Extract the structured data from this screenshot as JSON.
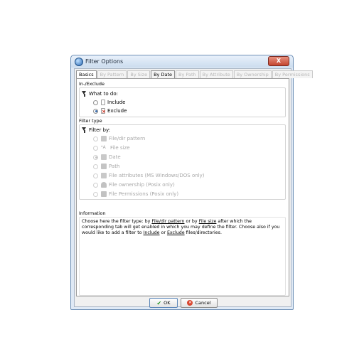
{
  "window": {
    "title": "Filter Options",
    "close_label": "X"
  },
  "tabs": [
    {
      "label": "Basics"
    },
    {
      "label": "By Pattern"
    },
    {
      "label": "By Size"
    },
    {
      "label": "By Date"
    },
    {
      "label": "By Path"
    },
    {
      "label": "By Attribute"
    },
    {
      "label": "By Ownership"
    },
    {
      "label": "By Permissions"
    }
  ],
  "include_exclude": {
    "title": "In-/Exclude",
    "what_to_do": "What to do:",
    "options": [
      {
        "label": "Include",
        "selected": false
      },
      {
        "label": "Exclude",
        "selected": true
      }
    ]
  },
  "filter_type": {
    "title": "Filter type",
    "filter_by": "Filter by:",
    "options": [
      {
        "label": "File/dir pattern",
        "selected": false
      },
      {
        "label": "File size",
        "selected": false
      },
      {
        "label": "Date",
        "selected": true
      },
      {
        "label": "Path",
        "selected": false
      },
      {
        "label": "File attributes (MS Windows/DOS only)",
        "selected": false
      },
      {
        "label": "File ownership (Posix only)",
        "selected": false
      },
      {
        "label": "File Permissions (Posix only)",
        "selected": false
      }
    ]
  },
  "information": {
    "title": "Information",
    "t1": "Choose here the filter type: by ",
    "link1": "File/dir pattern",
    "t2": " or by ",
    "link2": "File size",
    "t3": " after which the corresponding tab will get enabled in which you may define the filter. Choose also if you would like to add a filter to ",
    "link3": "Include",
    "t4": " or ",
    "link4": "Exclude",
    "t5": " files/directories."
  },
  "buttons": {
    "ok": "OK",
    "cancel": "Cancel"
  }
}
